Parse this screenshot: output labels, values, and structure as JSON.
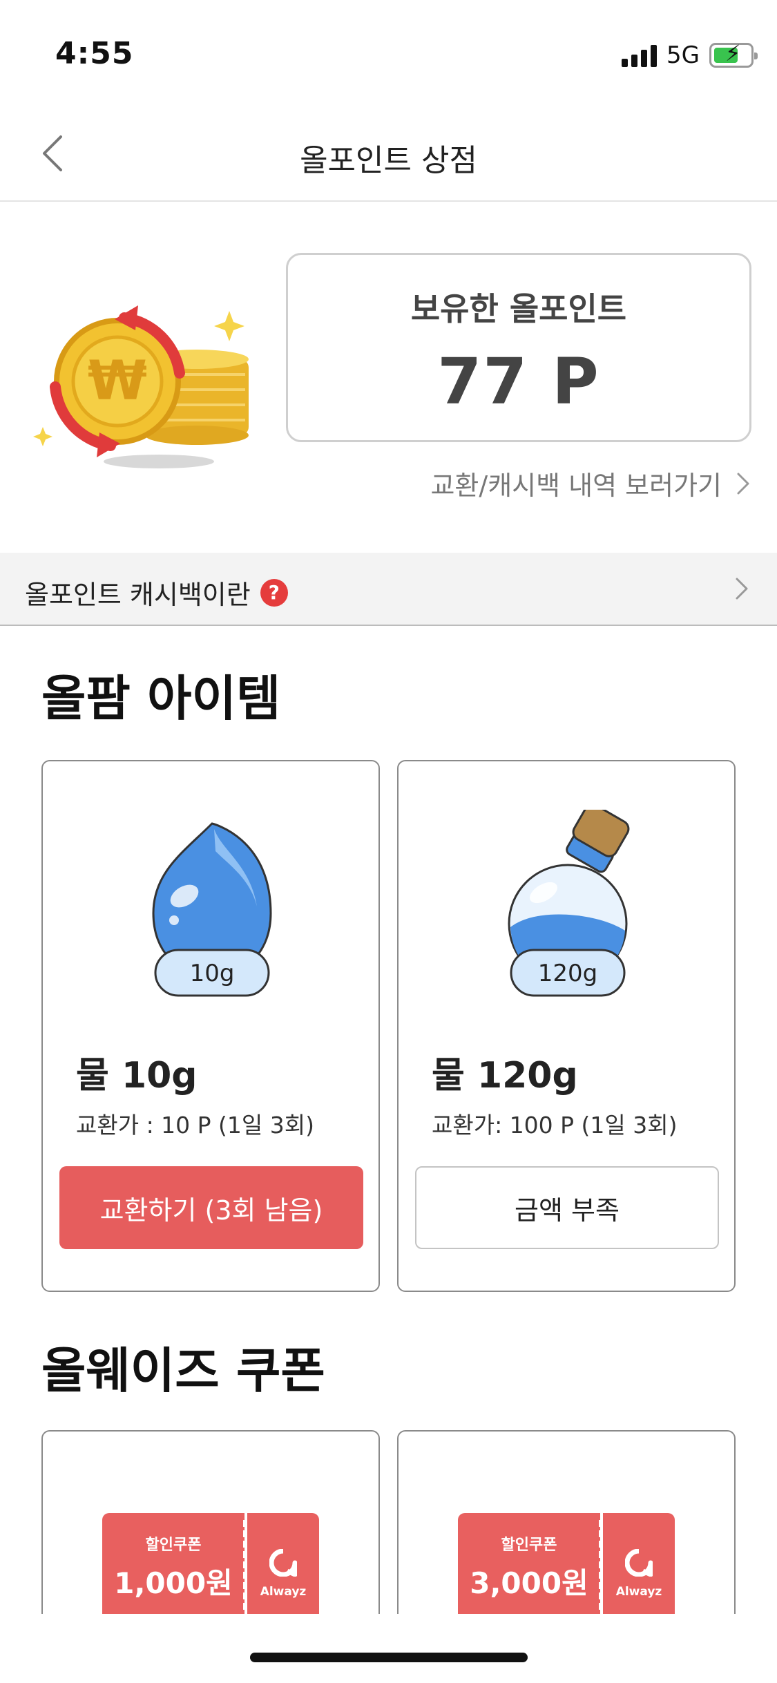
{
  "status_bar": {
    "time": "4:55",
    "network": "5G"
  },
  "header": {
    "title": "올포인트 상점"
  },
  "points": {
    "label": "보유한 올포인트",
    "value": "77 P",
    "history_link": "교환/캐시백 내역 보러가기"
  },
  "info_bar": {
    "text": "올포인트 캐시백이란",
    "help_glyph": "?"
  },
  "items_section": {
    "title": "올팜 아이템",
    "cards": [
      {
        "badge": "10g",
        "name": "물 10g",
        "price": "교환가 : 10 P (1일 3회)",
        "button": "교환하기 (3회 남음)",
        "enabled": true
      },
      {
        "badge": "120g",
        "name": "물 120g",
        "price": "교환가: 100 P (1일 3회)",
        "button": "금액 부족",
        "enabled": false
      }
    ]
  },
  "coupons_section": {
    "title": "올웨이즈 쿠폰",
    "cards": [
      {
        "label": "할인쿠폰",
        "amount": "1,000원",
        "brand": "Alwayz"
      },
      {
        "label": "할인쿠폰",
        "amount": "3,000원",
        "brand": "Alwayz"
      }
    ]
  },
  "colors": {
    "accent": "#e65d5d",
    "coupon": "#e8605f",
    "help": "#e53c3c",
    "water": "#4a90e2",
    "coin": "#f2c230"
  },
  "icons": [
    "back-chevron-icon",
    "chevron-right-icon",
    "help-icon",
    "coin-exchange-icon",
    "water-drop-icon",
    "water-bottle-icon",
    "alwayz-logo-icon",
    "signal-icon",
    "battery-icon"
  ]
}
